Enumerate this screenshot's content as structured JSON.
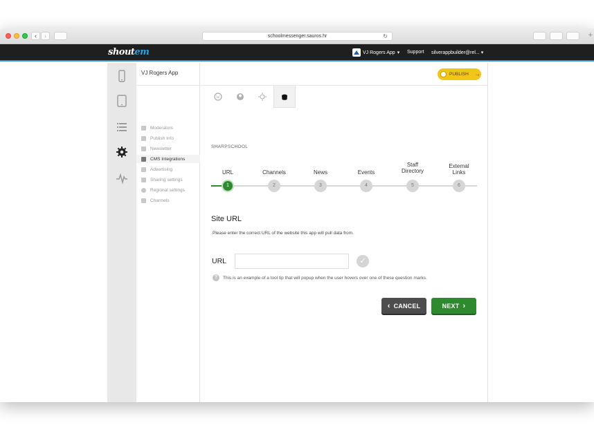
{
  "browser": {
    "url": "schoolmessenger.sauros.hr"
  },
  "appbar": {
    "logo_main": "shout",
    "logo_accent": "em",
    "app_name": "VJ Rogers App",
    "support": "Support",
    "user": "silverappbuilder@rel..."
  },
  "iconbar": {
    "items": [
      "phone-icon",
      "tablet-icon",
      "list-icon",
      "settings-gear-icon",
      "analytics-icon"
    ],
    "active": "settings-gear-icon"
  },
  "subnav": {
    "title": "VJ Rogers App",
    "items": [
      {
        "label": "Moderators",
        "icon": "moderators-icon"
      },
      {
        "label": "Publish Info",
        "icon": "publish-info-icon"
      },
      {
        "label": "Newsletter",
        "icon": "newsletter-icon"
      },
      {
        "label": "CMS Integrations",
        "icon": "link-icon",
        "active": true
      },
      {
        "label": "Advertising",
        "icon": "megaphone-icon"
      },
      {
        "label": "Sharing settings",
        "icon": "share-icon"
      },
      {
        "label": "Regional settings",
        "icon": "globe-icon"
      },
      {
        "label": "Channels",
        "icon": "channels-icon"
      }
    ]
  },
  "main": {
    "publish_label": "PUBLISH",
    "integration_tabs": [
      "wordpress-icon",
      "joomla-icon",
      "drupal-icon",
      "sharpschool-icon"
    ],
    "integration_name": "SHARPSCHOOL",
    "steps": [
      {
        "label": "URL",
        "num": "1"
      },
      {
        "label": "Channels",
        "num": "2"
      },
      {
        "label": "News",
        "num": "3"
      },
      {
        "label": "Events",
        "num": "4"
      },
      {
        "label": "Staff Directory",
        "num": "5"
      },
      {
        "label": "External Links",
        "num": "6"
      }
    ],
    "active_step": 1,
    "section_title": "Site URL",
    "section_description": "Please enter the correct URL of the website this app will pull data from.",
    "url_label": "URL",
    "url_value": "",
    "url_placeholder": "",
    "tooltip": "This is an example of a tool tip that will popup when the user hovers over one of these question marks.",
    "cancel_label": "CANCEL",
    "next_label": "NEXT"
  },
  "colors": {
    "accent_green": "#2f8a2f",
    "publish_yellow": "#f3c51b",
    "topbar": "#1f1f1f",
    "logo_blue": "#2ea1e0"
  }
}
